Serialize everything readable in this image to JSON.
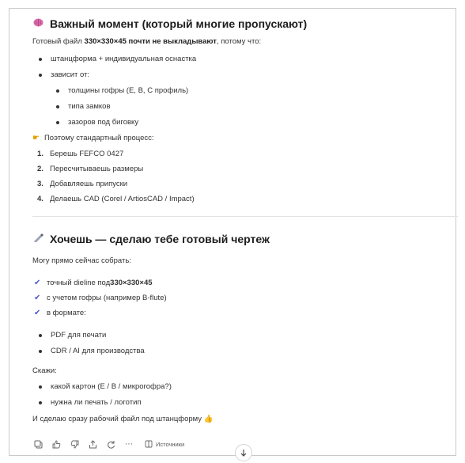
{
  "section1": {
    "icon": "brain-icon",
    "title": "Важный момент (который многие пропускают)",
    "intro_prefix": "Готовый файл ",
    "intro_bold": "330×330×45 почти не выкладывают",
    "intro_suffix": ", потому что:",
    "bullets": [
      "штанцформа + индивидуальная оснастка",
      "зависит от:"
    ],
    "sub_bullets": [
      "толщины гофры (E, B, C профиль)",
      "типа замков",
      "зазоров под биговку"
    ],
    "process_label": "Поэтому стандартный процесс:",
    "steps": [
      {
        "num": "1.",
        "text": "Берешь FEFCO 0427"
      },
      {
        "num": "2.",
        "text": "Пересчитываешь размеры"
      },
      {
        "num": "3.",
        "text": "Добавляешь припуски"
      },
      {
        "num": "4.",
        "text": "Делаешь CAD (Corel / ArtiosCAD / Impact)"
      }
    ]
  },
  "section2": {
    "icon": "ruler-pencil-icon",
    "title": "Хочешь — сделаю тебе готовый чертеж",
    "intro": "Могу прямо сейчас собрать:",
    "checks": [
      {
        "prefix": "точный dieline под ",
        "bold": "330×330×45"
      },
      {
        "prefix": "с учетом гофры (например B-flute)",
        "bold": ""
      },
      {
        "prefix": "в формате:",
        "bold": ""
      }
    ],
    "formats": [
      "PDF для печати",
      "CDR / AI для производства"
    ],
    "ask_label": "Скажи:",
    "questions": [
      "какой картон (E / B / микрогофра?)",
      "нужна ли печать / логотип"
    ],
    "closing": "И сделаю сразу рабочий файл под штанцформу"
  },
  "actions": {
    "sources_label": "Источники"
  }
}
